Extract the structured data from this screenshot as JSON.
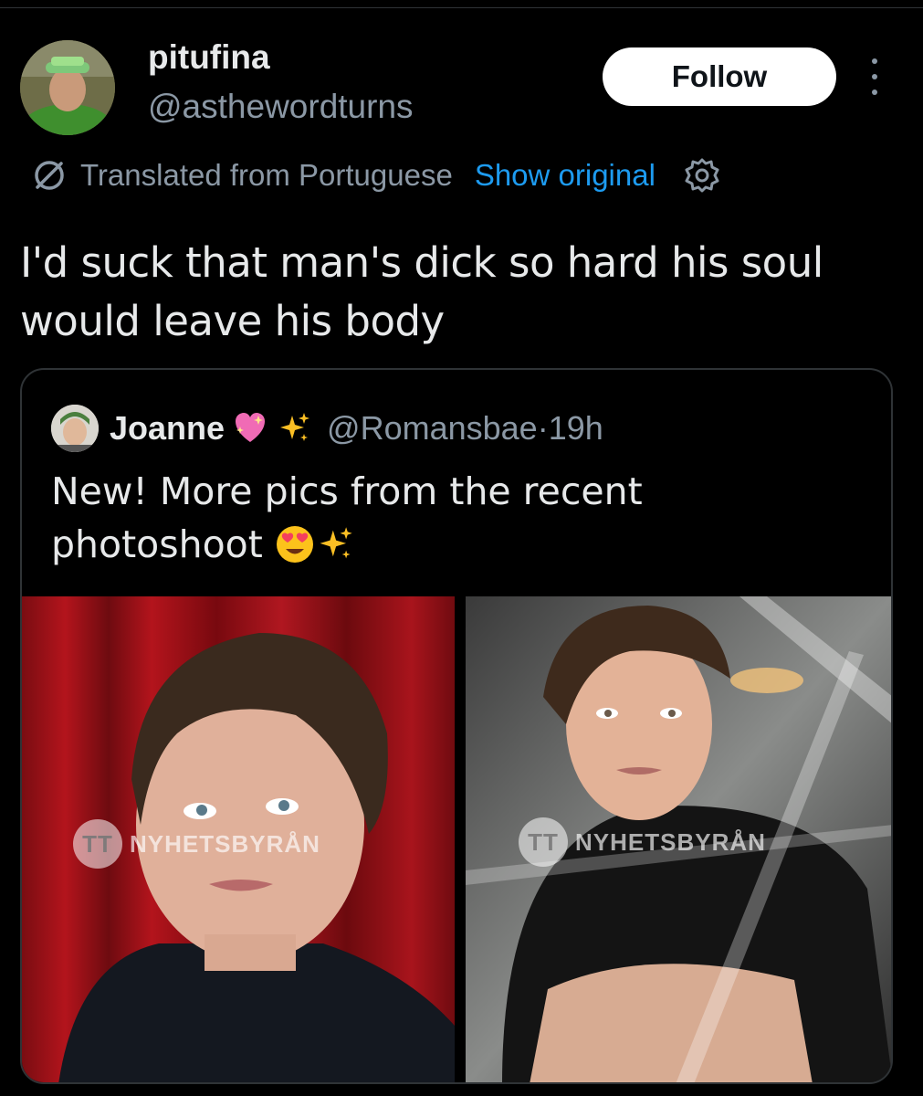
{
  "post": {
    "author": {
      "display_name": "pitufina",
      "handle": "@asthewordturns"
    },
    "follow_label": "Follow",
    "translation": {
      "notice": "Translated from Portuguese",
      "show_original": "Show original"
    },
    "text": "I'd suck that man's dick so hard his soul would leave his body"
  },
  "quoted": {
    "author": {
      "display_name": "Joanne",
      "handle": "@Romansbae",
      "time_sep": " · ",
      "time": "19h"
    },
    "text": "New! More pics from the recent photoshoot",
    "photos": [
      {
        "watermark": "NYHETSBYRÅN",
        "watermark_logo": "TT"
      },
      {
        "watermark": "NYHETSBYRÅN",
        "watermark_logo": "TT"
      }
    ]
  },
  "icons": {
    "more": "more-icon",
    "translate": "translate-icon",
    "settings": "gear-icon",
    "heart": "sparkling-heart-emoji",
    "sparkles": "sparkles-emoji",
    "heart_eyes": "heart-eyes-emoji"
  },
  "colors": {
    "background": "#000000",
    "text_primary": "#e7e9ea",
    "text_secondary": "#8b98a5",
    "link": "#1d9bf0",
    "border": "#2f3336"
  }
}
